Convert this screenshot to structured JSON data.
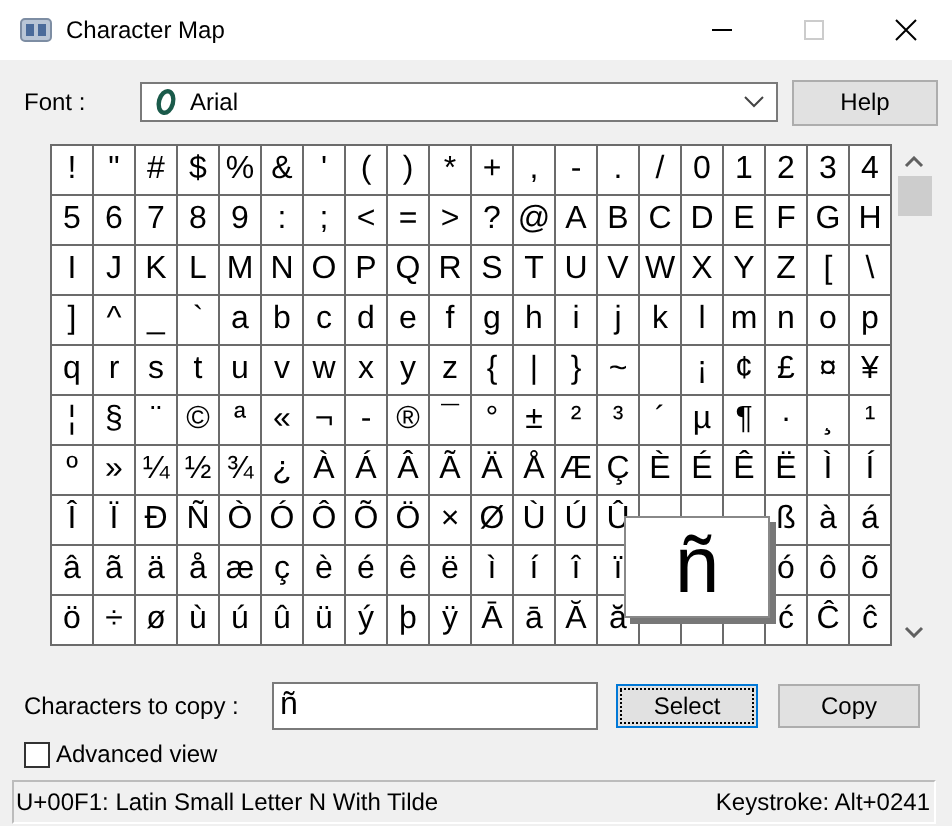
{
  "window": {
    "title": "Character Map"
  },
  "font": {
    "label": "Font :",
    "value": "Arial"
  },
  "help_button": {
    "label": "Help"
  },
  "grid": {
    "rows": [
      [
        "!",
        "\"",
        "#",
        "$",
        "%",
        "&",
        "'",
        "(",
        ")",
        "*",
        "+",
        ",",
        "-",
        ".",
        "/",
        "0",
        "1",
        "2",
        "3",
        "4"
      ],
      [
        "5",
        "6",
        "7",
        "8",
        "9",
        ":",
        ";",
        "<",
        "=",
        ">",
        "?",
        "@",
        "A",
        "B",
        "C",
        "D",
        "E",
        "F",
        "G",
        "H"
      ],
      [
        "I",
        "J",
        "K",
        "L",
        "M",
        "N",
        "O",
        "P",
        "Q",
        "R",
        "S",
        "T",
        "U",
        "V",
        "W",
        "X",
        "Y",
        "Z",
        "[",
        "\\"
      ],
      [
        "]",
        "^",
        "_",
        "`",
        "a",
        "b",
        "c",
        "d",
        "e",
        "f",
        "g",
        "h",
        "i",
        "j",
        "k",
        "l",
        "m",
        "n",
        "o",
        "p"
      ],
      [
        "q",
        "r",
        "s",
        "t",
        "u",
        "v",
        "w",
        "x",
        "y",
        "z",
        "{",
        "|",
        "}",
        "~",
        null,
        "¡",
        "¢",
        "£",
        "¤",
        "¥"
      ],
      [
        "¦",
        "§",
        "¨",
        "©",
        "ª",
        "«",
        "¬",
        "-",
        "®",
        "¯",
        "°",
        "±",
        "²",
        "³",
        "´",
        "µ",
        "¶",
        "·",
        "¸",
        "¹"
      ],
      [
        "º",
        "»",
        "¼",
        "½",
        "¾",
        "¿",
        "À",
        "Á",
        "Â",
        "Ã",
        "Ä",
        "Å",
        "Æ",
        "Ç",
        "È",
        "É",
        "Ê",
        "Ë",
        "Ì",
        "Í"
      ],
      [
        "Î",
        "Ï",
        "Ð",
        "Ñ",
        "Ò",
        "Ó",
        "Ô",
        "Õ",
        "Ö",
        "×",
        "Ø",
        "Ù",
        "Ú",
        "Û",
        null,
        null,
        null,
        "ß",
        "à",
        "á"
      ],
      [
        "â",
        "ã",
        "ä",
        "å",
        "æ",
        "ç",
        "è",
        "é",
        "ê",
        "ë",
        "ì",
        "í",
        "î",
        "ï",
        null,
        null,
        null,
        "ó",
        "ô",
        "õ"
      ],
      [
        "ö",
        "÷",
        "ø",
        "ù",
        "ú",
        "û",
        "ü",
        "ý",
        "þ",
        "ÿ",
        "Ā",
        "ā",
        "Ă",
        "ă",
        null,
        null,
        null,
        "ć",
        "Ĉ",
        "ĉ"
      ]
    ],
    "magnified": "ñ"
  },
  "copy": {
    "label": "Characters to copy :",
    "value": "ñ"
  },
  "buttons": [
    {
      "label": "Select",
      "focused": true
    },
    {
      "label": "Copy",
      "focused": false
    }
  ],
  "advanced": {
    "label": "Advanced view",
    "checked": false
  },
  "status_bar": {
    "description": "U+00F1: Latin Small Letter N With Tilde",
    "keystroke": "Keystroke: Alt+0241"
  }
}
